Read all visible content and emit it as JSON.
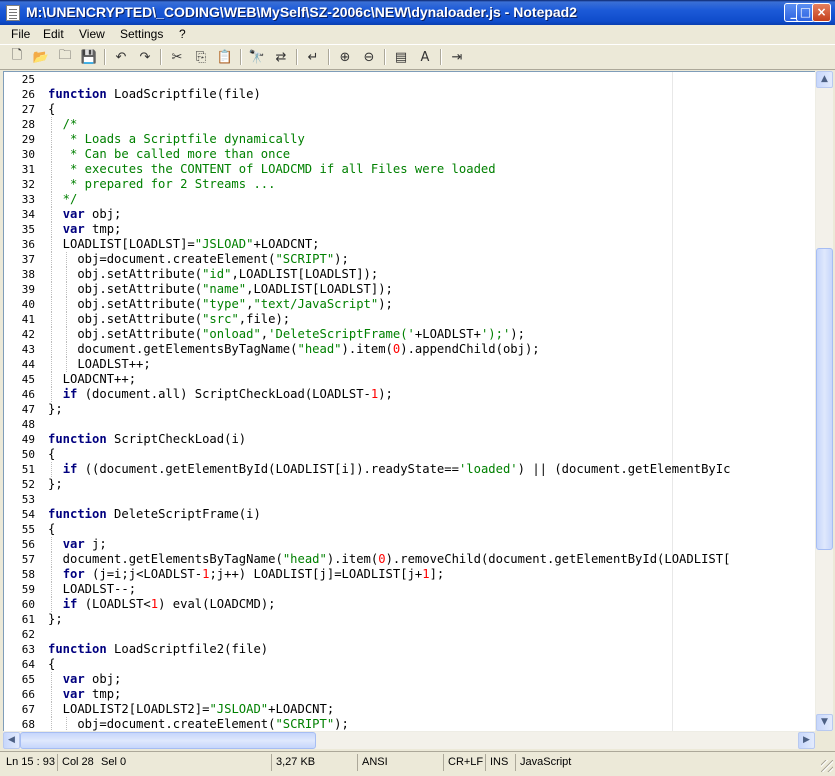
{
  "window": {
    "title": "M:\\UNENCRYPTED\\_CODING\\WEB\\MySelf\\SZ-2006c\\NEW\\dynaloader.js - Notepad2",
    "caption_buttons": [
      "minimize-icon",
      "maximize-icon",
      "close-icon"
    ]
  },
  "menu": [
    "File",
    "Edit",
    "View",
    "Settings",
    "?"
  ],
  "toolbar_icons": [
    "new-file-icon",
    "open-folder-icon",
    "browse-icon",
    "save-icon",
    "undo-icon",
    "redo-icon",
    "cut-icon",
    "copy-icon",
    "paste-icon",
    "find-icon",
    "replace-icon",
    "word-wrap-icon",
    "zoom-in-icon",
    "zoom-out-icon",
    "select-scheme-icon",
    "customize-scheme-icon",
    "exit-icon"
  ],
  "editor": {
    "lines": [
      {
        "n": "25",
        "t": ""
      },
      {
        "n": "26",
        "t": "function LoadScriptfile(file)"
      },
      {
        "n": "27",
        "t": "{"
      },
      {
        "n": "28",
        "t": "  /*"
      },
      {
        "n": "29",
        "t": "   * Loads a Scriptfile dynamically"
      },
      {
        "n": "30",
        "t": "   * Can be called more than once"
      },
      {
        "n": "31",
        "t": "   * executes the CONTENT of LOADCMD if all Files were loaded"
      },
      {
        "n": "32",
        "t": "   * prepared for 2 Streams ..."
      },
      {
        "n": "33",
        "t": "  */"
      },
      {
        "n": "34",
        "t": "  var obj;"
      },
      {
        "n": "35",
        "t": "  var tmp;"
      },
      {
        "n": "36",
        "t": "  LOADLIST[LOADLST]=\"JSLOAD\"+LOADCNT;"
      },
      {
        "n": "37",
        "t": "    obj=document.createElement(\"SCRIPT\");"
      },
      {
        "n": "38",
        "t": "    obj.setAttribute(\"id\",LOADLIST[LOADLST]);"
      },
      {
        "n": "39",
        "t": "    obj.setAttribute(\"name\",LOADLIST[LOADLST]);"
      },
      {
        "n": "40",
        "t": "    obj.setAttribute(\"type\",\"text/JavaScript\");"
      },
      {
        "n": "41",
        "t": "    obj.setAttribute(\"src\",file);"
      },
      {
        "n": "42",
        "t": "    obj.setAttribute(\"onload\",'DeleteScriptFrame('+LOADLST+');');"
      },
      {
        "n": "43",
        "t": "    document.getElementsByTagName(\"head\").item(0).appendChild(obj);"
      },
      {
        "n": "44",
        "t": "    LOADLST++;"
      },
      {
        "n": "45",
        "t": "  LOADCNT++;"
      },
      {
        "n": "46",
        "t": "  if (document.all) ScriptCheckLoad(LOADLST-1);"
      },
      {
        "n": "47",
        "t": "};"
      },
      {
        "n": "48",
        "t": ""
      },
      {
        "n": "49",
        "t": "function ScriptCheckLoad(i)"
      },
      {
        "n": "50",
        "t": "{"
      },
      {
        "n": "51",
        "t": "  if ((document.getElementById(LOADLIST[i]).readyState=='loaded') || (document.getElementByIc"
      },
      {
        "n": "52",
        "t": "};"
      },
      {
        "n": "53",
        "t": ""
      },
      {
        "n": "54",
        "t": "function DeleteScriptFrame(i)"
      },
      {
        "n": "55",
        "t": "{"
      },
      {
        "n": "56",
        "t": "  var j;"
      },
      {
        "n": "57",
        "t": "  document.getElementsByTagName(\"head\").item(0).removeChild(document.getElementById(LOADLIST["
      },
      {
        "n": "58",
        "t": "  for (j=i;j<LOADLST-1;j++) LOADLIST[j]=LOADLIST[j+1];"
      },
      {
        "n": "59",
        "t": "  LOADLST--;"
      },
      {
        "n": "60",
        "t": "  if (LOADLST<1) eval(LOADCMD);"
      },
      {
        "n": "61",
        "t": "};"
      },
      {
        "n": "62",
        "t": ""
      },
      {
        "n": "63",
        "t": "function LoadScriptfile2(file)"
      },
      {
        "n": "64",
        "t": "{"
      },
      {
        "n": "65",
        "t": "  var obj;"
      },
      {
        "n": "66",
        "t": "  var tmp;"
      },
      {
        "n": "67",
        "t": "  LOADLIST2[LOADLST2]=\"JSLOAD\"+LOADCNT;"
      },
      {
        "n": "68",
        "t": "    obj=document.createElement(\"SCRIPT\");"
      }
    ]
  },
  "status": {
    "position": "Ln 15 : 93",
    "column": "Col 28",
    "selection": "Sel 0",
    "size": "3,27 KB",
    "encoding": "ANSI",
    "line_endings": "CR+LF",
    "mode": "INS",
    "lexer": "JavaScript"
  }
}
